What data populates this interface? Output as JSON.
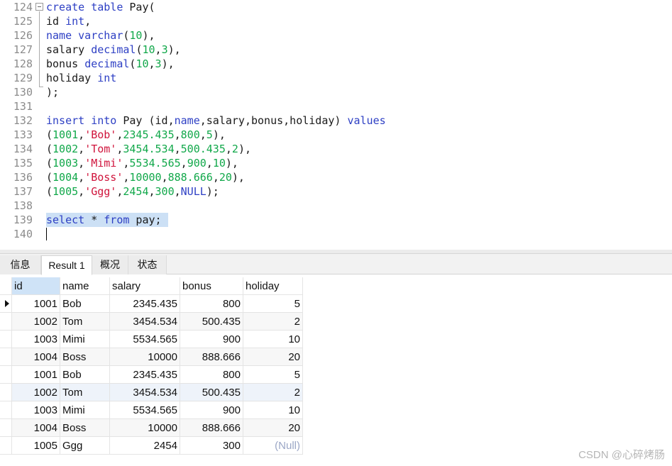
{
  "editor": {
    "lines": [
      {
        "num": "124",
        "tokens": [
          {
            "t": "create table",
            "c": "kw"
          },
          {
            "t": " Pay(",
            "c": "tx"
          }
        ]
      },
      {
        "num": "125",
        "tokens": [
          {
            "t": "id ",
            "c": "tx"
          },
          {
            "t": "int",
            "c": "kw"
          },
          {
            "t": ",",
            "c": "tx"
          }
        ]
      },
      {
        "num": "126",
        "tokens": [
          {
            "t": "name ",
            "c": "kw"
          },
          {
            "t": "varchar",
            "c": "kw"
          },
          {
            "t": "(",
            "c": "tx"
          },
          {
            "t": "10",
            "c": "num"
          },
          {
            "t": "),",
            "c": "tx"
          }
        ]
      },
      {
        "num": "127",
        "tokens": [
          {
            "t": "salary ",
            "c": "tx"
          },
          {
            "t": "decimal",
            "c": "kw"
          },
          {
            "t": "(",
            "c": "tx"
          },
          {
            "t": "10",
            "c": "num"
          },
          {
            "t": ",",
            "c": "tx"
          },
          {
            "t": "3",
            "c": "num"
          },
          {
            "t": "),",
            "c": "tx"
          }
        ]
      },
      {
        "num": "128",
        "tokens": [
          {
            "t": "bonus ",
            "c": "tx"
          },
          {
            "t": "decimal",
            "c": "kw"
          },
          {
            "t": "(",
            "c": "tx"
          },
          {
            "t": "10",
            "c": "num"
          },
          {
            "t": ",",
            "c": "tx"
          },
          {
            "t": "3",
            "c": "num"
          },
          {
            "t": "),",
            "c": "tx"
          }
        ]
      },
      {
        "num": "129",
        "tokens": [
          {
            "t": "holiday ",
            "c": "tx"
          },
          {
            "t": "int",
            "c": "kw"
          }
        ]
      },
      {
        "num": "130",
        "tokens": [
          {
            "t": ");",
            "c": "tx"
          }
        ]
      },
      {
        "num": "131",
        "tokens": []
      },
      {
        "num": "132",
        "tokens": [
          {
            "t": "insert into",
            "c": "kw"
          },
          {
            "t": " Pay (id,",
            "c": "tx"
          },
          {
            "t": "name",
            "c": "kw"
          },
          {
            "t": ",salary,bonus,holiday) ",
            "c": "tx"
          },
          {
            "t": "values",
            "c": "kw"
          }
        ]
      },
      {
        "num": "133",
        "tokens": [
          {
            "t": "(",
            "c": "tx"
          },
          {
            "t": "1001",
            "c": "num"
          },
          {
            "t": ",",
            "c": "tx"
          },
          {
            "t": "'Bob'",
            "c": "str"
          },
          {
            "t": ",",
            "c": "tx"
          },
          {
            "t": "2345.435",
            "c": "num"
          },
          {
            "t": ",",
            "c": "tx"
          },
          {
            "t": "800",
            "c": "num"
          },
          {
            "t": ",",
            "c": "tx"
          },
          {
            "t": "5",
            "c": "num"
          },
          {
            "t": "),",
            "c": "tx"
          }
        ]
      },
      {
        "num": "134",
        "tokens": [
          {
            "t": "(",
            "c": "tx"
          },
          {
            "t": "1002",
            "c": "num"
          },
          {
            "t": ",",
            "c": "tx"
          },
          {
            "t": "'Tom'",
            "c": "str"
          },
          {
            "t": ",",
            "c": "tx"
          },
          {
            "t": "3454.534",
            "c": "num"
          },
          {
            "t": ",",
            "c": "tx"
          },
          {
            "t": "500.435",
            "c": "num"
          },
          {
            "t": ",",
            "c": "tx"
          },
          {
            "t": "2",
            "c": "num"
          },
          {
            "t": "),",
            "c": "tx"
          }
        ]
      },
      {
        "num": "135",
        "tokens": [
          {
            "t": "(",
            "c": "tx"
          },
          {
            "t": "1003",
            "c": "num"
          },
          {
            "t": ",",
            "c": "tx"
          },
          {
            "t": "'Mimi'",
            "c": "str"
          },
          {
            "t": ",",
            "c": "tx"
          },
          {
            "t": "5534.565",
            "c": "num"
          },
          {
            "t": ",",
            "c": "tx"
          },
          {
            "t": "900",
            "c": "num"
          },
          {
            "t": ",",
            "c": "tx"
          },
          {
            "t": "10",
            "c": "num"
          },
          {
            "t": "),",
            "c": "tx"
          }
        ]
      },
      {
        "num": "136",
        "tokens": [
          {
            "t": "(",
            "c": "tx"
          },
          {
            "t": "1004",
            "c": "num"
          },
          {
            "t": ",",
            "c": "tx"
          },
          {
            "t": "'Boss'",
            "c": "str"
          },
          {
            "t": ",",
            "c": "tx"
          },
          {
            "t": "10000",
            "c": "num"
          },
          {
            "t": ",",
            "c": "tx"
          },
          {
            "t": "888.666",
            "c": "num"
          },
          {
            "t": ",",
            "c": "tx"
          },
          {
            "t": "20",
            "c": "num"
          },
          {
            "t": "),",
            "c": "tx"
          }
        ]
      },
      {
        "num": "137",
        "tokens": [
          {
            "t": "(",
            "c": "tx"
          },
          {
            "t": "1005",
            "c": "num"
          },
          {
            "t": ",",
            "c": "tx"
          },
          {
            "t": "'Ggg'",
            "c": "str"
          },
          {
            "t": ",",
            "c": "tx"
          },
          {
            "t": "2454",
            "c": "num"
          },
          {
            "t": ",",
            "c": "tx"
          },
          {
            "t": "300",
            "c": "num"
          },
          {
            "t": ",",
            "c": "tx"
          },
          {
            "t": "NULL",
            "c": "nul"
          },
          {
            "t": ");",
            "c": "tx"
          }
        ]
      },
      {
        "num": "138",
        "tokens": []
      },
      {
        "num": "139",
        "selected": true,
        "tokens": [
          {
            "t": "select",
            "c": "kw"
          },
          {
            "t": " * ",
            "c": "tx"
          },
          {
            "t": "from",
            "c": "kw"
          },
          {
            "t": " pay; ",
            "c": "tx"
          }
        ]
      },
      {
        "num": "140",
        "tokens": []
      }
    ]
  },
  "tabs": [
    {
      "label": "信息",
      "active": false
    },
    {
      "label": "Result 1",
      "active": true
    },
    {
      "label": "概况",
      "active": false
    },
    {
      "label": "状态",
      "active": false
    }
  ],
  "grid": {
    "columns": [
      "id",
      "name",
      "salary",
      "bonus",
      "holiday"
    ],
    "rows": [
      [
        "1001",
        "Bob",
        "2345.435",
        "800",
        "5"
      ],
      [
        "1002",
        "Tom",
        "3454.534",
        "500.435",
        "2"
      ],
      [
        "1003",
        "Mimi",
        "5534.565",
        "900",
        "10"
      ],
      [
        "1004",
        "Boss",
        "10000",
        "888.666",
        "20"
      ],
      [
        "1001",
        "Bob",
        "2345.435",
        "800",
        "5"
      ],
      [
        "1002",
        "Tom",
        "3454.534",
        "500.435",
        "2"
      ],
      [
        "1003",
        "Mimi",
        "5534.565",
        "900",
        "10"
      ],
      [
        "1004",
        "Boss",
        "10000",
        "888.666",
        "20"
      ],
      [
        "1005",
        "Ggg",
        "2454",
        "300",
        "(Null)"
      ]
    ],
    "current_row": 0,
    "highlight_row": 5
  },
  "watermark": "CSDN @心碎烤肠",
  "colors": {
    "keyword": "#2d3fc4",
    "number": "#11a84a",
    "string": "#d0143c",
    "selection": "#cce0f5",
    "null": "#9ba7c6"
  }
}
